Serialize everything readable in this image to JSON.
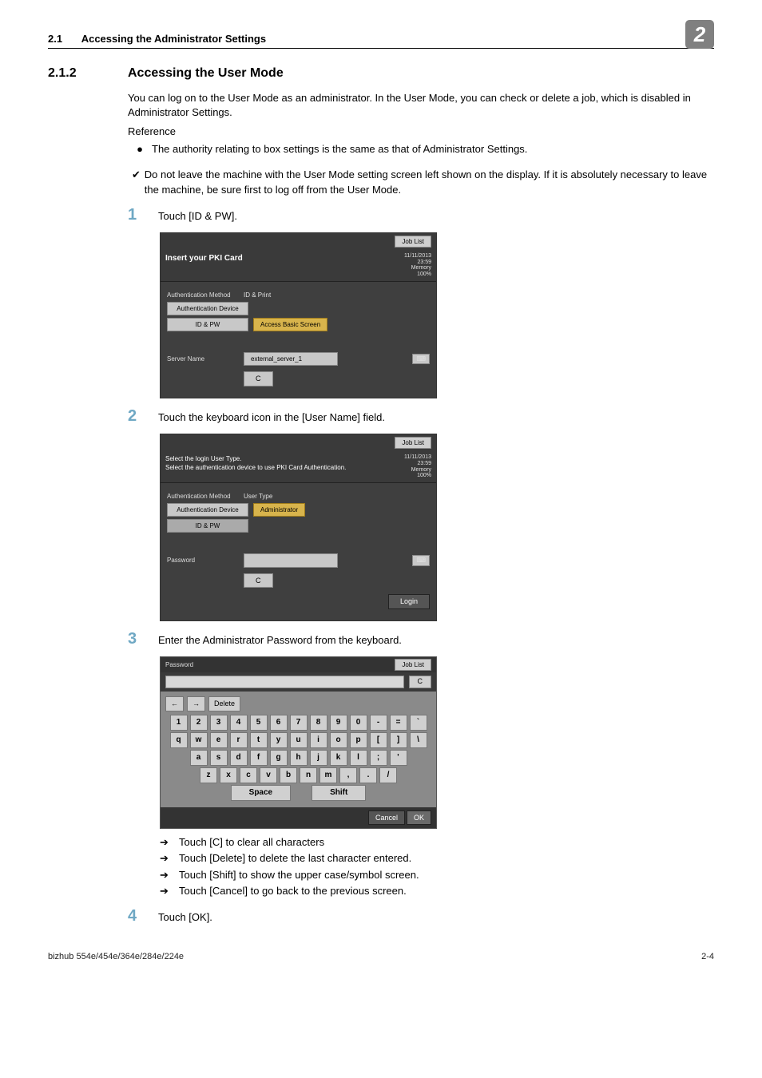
{
  "header": {
    "section_number": "2.1",
    "section_title": "Accessing the Administrator Settings",
    "chapter_badge": "2"
  },
  "subsection": {
    "number": "2.1.2",
    "title": "Accessing the User Mode"
  },
  "intro": {
    "p1": "You can log on to the User Mode as an administrator. In the User Mode, you can check or delete a job, which is disabled in Administrator Settings.",
    "ref_title": "Reference",
    "bullet1": "The authority relating to box settings is the same as that of Administrator Settings.",
    "check1": "Do not leave the machine with the User Mode setting screen left shown on the display. If it is absolutely necessary to leave the machine, be sure first to log off from the User Mode."
  },
  "steps": {
    "s1": "Touch [ID & PW].",
    "s2": "Touch the keyboard icon in the [User Name] field.",
    "s3": "Enter the Administrator Password from the keyboard.",
    "s4": "Touch [OK]."
  },
  "substeps": {
    "a1": "Touch [C] to clear all characters",
    "a2": "Touch [Delete] to delete the last character entered.",
    "a3": "Touch [Shift] to show the upper case/symbol screen.",
    "a4": "Touch [Cancel] to go back to the previous screen."
  },
  "scr1": {
    "job_list": "Job List",
    "title": "Insert your PKI Card",
    "ts_date": "11/11/2013",
    "ts_time": "23:59",
    "mem_l": "Memory",
    "mem_v": "100%",
    "auth_method_l": "Authentication Method",
    "auth_method_v": "ID & Print",
    "auth_device": "Authentication Device",
    "idpw": "ID & PW",
    "basic": "Access Basic Screen",
    "server_l": "Server Name",
    "server_v": "external_server_1",
    "clear": "C"
  },
  "scr2": {
    "job_list": "Job List",
    "t1": "Select the login User Type.",
    "t2": "Select the authentication device to use PKI Card Authentication.",
    "ts_date": "11/11/2013",
    "ts_time": "23:59",
    "mem_l": "Memory",
    "mem_v": "100%",
    "auth_method_l": "Authentication Method",
    "user_type_l": "User Type",
    "auth_device": "Authentication Device",
    "admin": "Administrator",
    "idpw": "ID & PW",
    "password_l": "Password",
    "clear": "C",
    "login": "Login"
  },
  "kbd": {
    "hdr": "Password",
    "job_list": "Job List",
    "clear": "C",
    "arrow_left": "←",
    "arrow_right": "→",
    "delete": "Delete",
    "row1": [
      "1",
      "2",
      "3",
      "4",
      "5",
      "6",
      "7",
      "8",
      "9",
      "0",
      "-",
      "=",
      "`"
    ],
    "row2": [
      "q",
      "w",
      "e",
      "r",
      "t",
      "y",
      "u",
      "i",
      "o",
      "p",
      "[",
      "]",
      "\\"
    ],
    "row3": [
      "a",
      "s",
      "d",
      "f",
      "g",
      "h",
      "j",
      "k",
      "l",
      ";",
      "'"
    ],
    "row4": [
      "z",
      "x",
      "c",
      "v",
      "b",
      "n",
      "m",
      ",",
      ".",
      "/"
    ],
    "space": "Space",
    "shift": "Shift",
    "cancel": "Cancel",
    "ok": "OK"
  },
  "footer": {
    "left": "bizhub 554e/454e/364e/284e/224e",
    "right": "2-4"
  }
}
